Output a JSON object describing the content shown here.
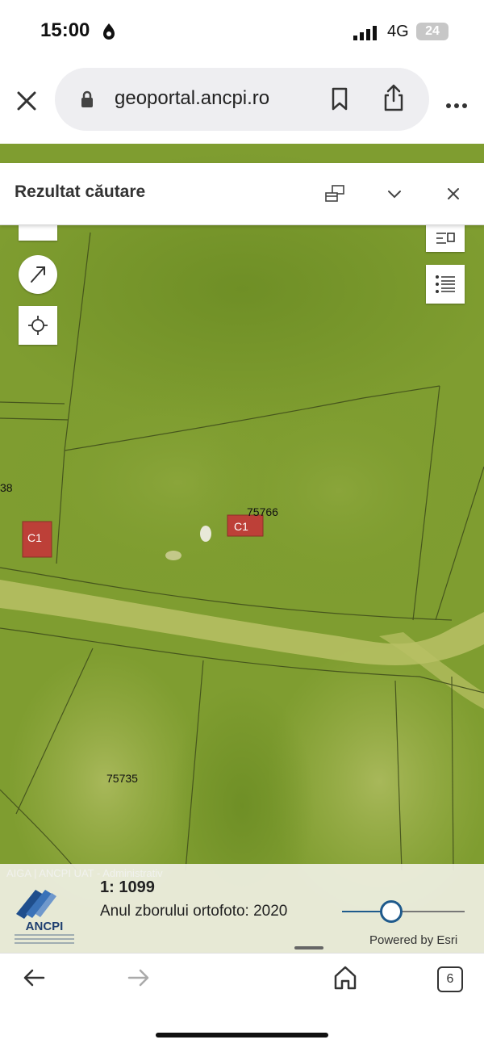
{
  "status_bar": {
    "time": "15:00",
    "network": "4G",
    "battery": "24"
  },
  "browser": {
    "url": "geoportal.ancpi.ro"
  },
  "panel": {
    "title": "Rezultat căutare"
  },
  "map": {
    "parcels": [
      {
        "id": "75766"
      },
      {
        "id": "75735"
      },
      {
        "id": "38"
      }
    ],
    "buildings": [
      {
        "label": "C1"
      },
      {
        "label": "C1"
      }
    ],
    "attribution": "AIGA | ANCPI UAT - Administrativ",
    "scale": "1: 1099",
    "ortho_year_label": "Anul zborului ortofoto: 2020",
    "slider_fraction": 0.4,
    "powered_by": "Powered by Esri",
    "logo_text": "ANCPI"
  },
  "toolbar": {
    "tab_count": "6"
  },
  "colors": {
    "accent": "#1f5a8c",
    "building": "#c8303a"
  }
}
